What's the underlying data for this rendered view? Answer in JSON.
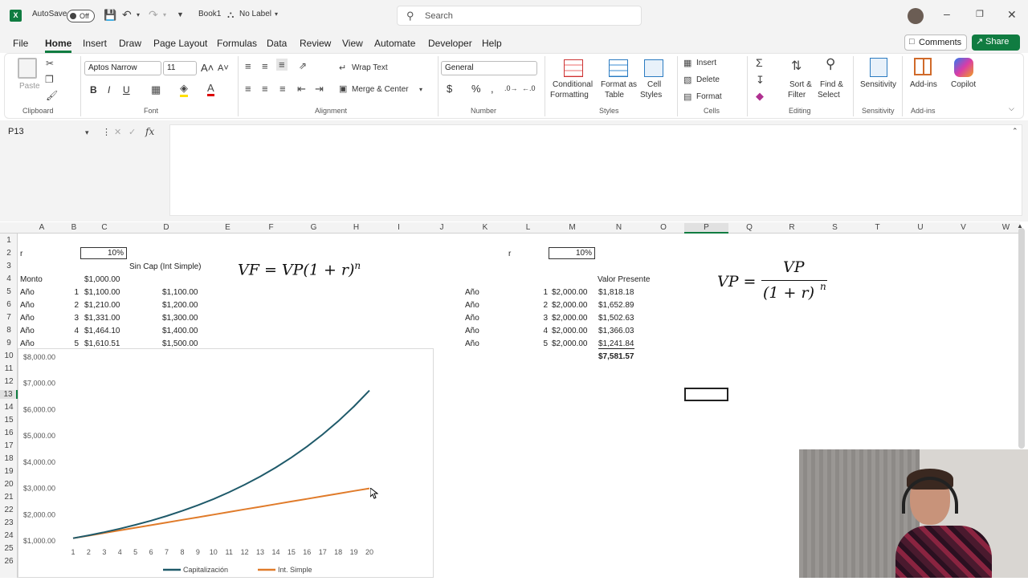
{
  "titlebar": {
    "autosave_label": "AutoSave",
    "autosave_state": "Off",
    "filename": "Book1",
    "label": "No Label",
    "search_placeholder": "Search"
  },
  "menu": [
    "File",
    "Home",
    "Insert",
    "Draw",
    "Page Layout",
    "Formulas",
    "Data",
    "Review",
    "View",
    "Automate",
    "Developer",
    "Help"
  ],
  "actions": {
    "comments": "Comments",
    "share": "Share"
  },
  "ribbon": {
    "paste": "Paste",
    "font_name": "Aptos Narrow",
    "font_size": "11",
    "wrap_text": "Wrap Text",
    "merge_center": "Merge & Center",
    "number_format": "General",
    "conditional": "Conditional",
    "formatting": "Formatting",
    "format_as": "Format as",
    "table": "Table",
    "cell": "Cell",
    "styles": "Styles",
    "insert": "Insert",
    "delete": "Delete",
    "format": "Format",
    "sort": "Sort &",
    "filter": "Filter",
    "find": "Find &",
    "select": "Select",
    "sensitivity": "Sensitivity",
    "addins": "Add-ins",
    "copilot": "Copilot",
    "groups": {
      "clipboard": "Clipboard",
      "font": "Font",
      "alignment": "Alignment",
      "number": "Number",
      "styles": "Styles",
      "cells": "Cells",
      "editing": "Editing",
      "sensitivity": "Sensitivity",
      "addins": "Add-ins"
    }
  },
  "namebox": "P13",
  "columns": [
    "A",
    "B",
    "C",
    "D",
    "E",
    "F",
    "G",
    "H",
    "I",
    "J",
    "K",
    "L",
    "M",
    "N",
    "O",
    "P",
    "Q",
    "R",
    "S",
    "T",
    "U",
    "V",
    "W"
  ],
  "rows": [
    "1",
    "2",
    "3",
    "4",
    "5",
    "6",
    "7",
    "8",
    "9",
    "10",
    "11",
    "12",
    "13",
    "14",
    "15",
    "16",
    "17",
    "18",
    "19",
    "20",
    "21",
    "22",
    "23",
    "24",
    "25",
    "26"
  ],
  "sheet": {
    "r_label": "r",
    "r_value": "10%",
    "sin_cap": "Sin Cap (Int Simple)",
    "monto_label": "Monto",
    "monto_value": "$1,000.00",
    "ano": "Año",
    "left_rows": [
      {
        "n": "1",
        "cap": "$1,100.00",
        "simple": "$1,100.00"
      },
      {
        "n": "2",
        "cap": "$1,210.00",
        "simple": "$1,200.00"
      },
      {
        "n": "3",
        "cap": "$1,331.00",
        "simple": "$1,300.00"
      },
      {
        "n": "4",
        "cap": "$1,464.10",
        "simple": "$1,400.00"
      },
      {
        "n": "5",
        "cap": "$1,610.51",
        "simple": "$1,500.00"
      }
    ],
    "formula_left": "VF = VP(1 + r)",
    "formula_left_exp": "n",
    "r2_label": "r",
    "r2_value": "10%",
    "valor_presente": "Valor Presente",
    "right_rows": [
      {
        "n": "1",
        "flow": "$2,000.00",
        "vp": "$1,818.18"
      },
      {
        "n": "2",
        "flow": "$2,000.00",
        "vp": "$1,652.89"
      },
      {
        "n": "3",
        "flow": "$2,000.00",
        "vp": "$1,502.63"
      },
      {
        "n": "4",
        "flow": "$2,000.00",
        "vp": "$1,366.03"
      },
      {
        "n": "5",
        "flow": "$2,000.00",
        "vp": "$1,241.84"
      }
    ],
    "total_vp": "$7,581.57",
    "formula_right_lhs": "VP =",
    "formula_right_num": "VP",
    "formula_right_den": "(1 + r)",
    "formula_right_exp": "n"
  },
  "chart_data": {
    "type": "line",
    "x": [
      1,
      2,
      3,
      4,
      5,
      6,
      7,
      8,
      9,
      10,
      11,
      12,
      13,
      14,
      15,
      16,
      17,
      18,
      19,
      20
    ],
    "series": [
      {
        "name": "Capitalización",
        "color": "#1f5a6a",
        "values": [
          1100,
          1210,
          1331,
          1464.1,
          1610.51,
          1771.56,
          1948.72,
          2143.59,
          2357.95,
          2593.74,
          2853.12,
          3138.43,
          3452.27,
          3797.5,
          4177.25,
          4594.97,
          5054.47,
          5559.92,
          6115.91,
          6727.5
        ]
      },
      {
        "name": "Int. Simple",
        "color": "#e07b2a",
        "values": [
          1100,
          1200,
          1300,
          1400,
          1500,
          1600,
          1700,
          1800,
          1900,
          2000,
          2100,
          2200,
          2300,
          2400,
          2500,
          2600,
          2700,
          2800,
          2900,
          3000
        ]
      }
    ],
    "ylim": [
      1000,
      8000
    ],
    "yticks": [
      "$1,000.00",
      "$2,000.00",
      "$3,000.00",
      "$4,000.00",
      "$5,000.00",
      "$6,000.00",
      "$7,000.00",
      "$8,000.00"
    ],
    "legend": "bottom",
    "grid": false
  }
}
